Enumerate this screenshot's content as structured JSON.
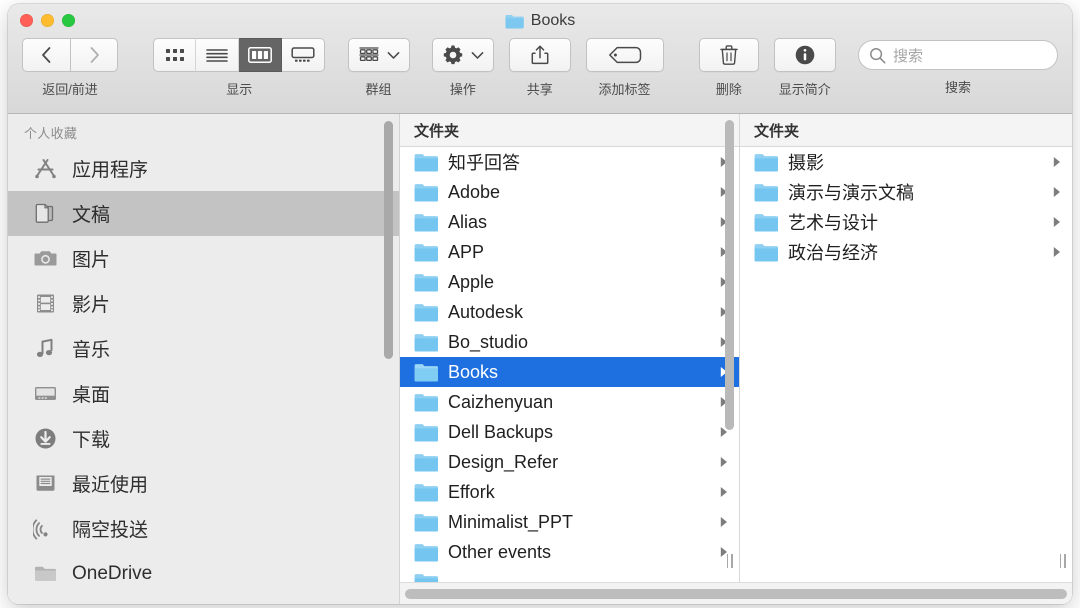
{
  "window": {
    "title": "Books",
    "title_icon": "folder-icon",
    "traffic_lights": [
      {
        "name": "close",
        "color": "#ff5f57"
      },
      {
        "name": "minimize",
        "color": "#febc2e"
      },
      {
        "name": "zoom",
        "color": "#28c840"
      }
    ]
  },
  "toolbar": {
    "nav": {
      "caption": "返回/前进",
      "back_icon": "chevron-left-icon",
      "forward_icon": "chevron-right-icon"
    },
    "view": {
      "caption": "显示",
      "modes": [
        {
          "name": "icon-view",
          "icon": "grid-icon",
          "active": false
        },
        {
          "name": "list-view",
          "icon": "list-icon",
          "active": false
        },
        {
          "name": "column-view",
          "icon": "columns-icon",
          "active": true
        },
        {
          "name": "gallery-view",
          "icon": "gallery-icon",
          "active": false
        }
      ]
    },
    "group": {
      "caption": "群组",
      "icon": "group-rows-icon",
      "chevron": "chevron-down-icon"
    },
    "action": {
      "caption": "操作",
      "icon": "gear-icon",
      "chevron": "chevron-down-icon"
    },
    "share": {
      "caption": "共享",
      "icon": "share-icon"
    },
    "tag": {
      "caption": "添加标签",
      "icon": "tag-icon"
    },
    "delete": {
      "caption": "删除",
      "icon": "trash-icon"
    },
    "info": {
      "caption": "显示简介",
      "icon": "info-circle-icon"
    },
    "search": {
      "caption": "搜索",
      "placeholder": "搜索",
      "value": "",
      "icon": "search-icon"
    }
  },
  "sidebar": {
    "section_title": "个人收藏",
    "items": [
      {
        "label": "应用程序",
        "icon": "applications-icon",
        "selected": false
      },
      {
        "label": "文稿",
        "icon": "documents-icon",
        "selected": true
      },
      {
        "label": "图片",
        "icon": "pictures-camera-icon",
        "selected": false
      },
      {
        "label": "影片",
        "icon": "movies-film-icon",
        "selected": false
      },
      {
        "label": "音乐",
        "icon": "music-note-icon",
        "selected": false
      },
      {
        "label": "桌面",
        "icon": "desktop-monitor-icon",
        "selected": false
      },
      {
        "label": "下载",
        "icon": "downloads-arrow-icon",
        "selected": false
      },
      {
        "label": "最近使用",
        "icon": "recents-tray-icon",
        "selected": false
      },
      {
        "label": "隔空投送",
        "icon": "airdrop-icon",
        "selected": false
      },
      {
        "label": "OneDrive",
        "icon": "gray-folder-icon",
        "selected": false
      }
    ]
  },
  "columns": [
    {
      "header": "文件夹",
      "items": [
        {
          "name": "知乎回答",
          "icon": "folder-icon",
          "has_children": true,
          "selected": false
        },
        {
          "name": "Adobe",
          "icon": "folder-icon",
          "has_children": true,
          "selected": false
        },
        {
          "name": "Alias",
          "icon": "folder-icon",
          "has_children": true,
          "selected": false
        },
        {
          "name": "APP",
          "icon": "folder-icon",
          "has_children": true,
          "selected": false
        },
        {
          "name": "Apple",
          "icon": "folder-icon",
          "has_children": true,
          "selected": false
        },
        {
          "name": "Autodesk",
          "icon": "folder-icon",
          "has_children": true,
          "selected": false
        },
        {
          "name": "Bo_studio",
          "icon": "folder-icon",
          "has_children": true,
          "selected": false
        },
        {
          "name": "Books",
          "icon": "folder-icon",
          "has_children": true,
          "selected": true
        },
        {
          "name": "Caizhenyuan",
          "icon": "folder-icon",
          "has_children": true,
          "selected": false
        },
        {
          "name": "Dell Backups",
          "icon": "folder-icon",
          "has_children": true,
          "selected": false
        },
        {
          "name": "Design_Refer",
          "icon": "folder-icon",
          "has_children": true,
          "selected": false
        },
        {
          "name": "Effork",
          "icon": "folder-icon",
          "has_children": true,
          "selected": false
        },
        {
          "name": "Minimalist_PPT",
          "icon": "folder-icon",
          "has_children": true,
          "selected": false
        },
        {
          "name": "Other events",
          "icon": "folder-icon",
          "has_children": true,
          "selected": false
        }
      ]
    },
    {
      "header": "文件夹",
      "items": [
        {
          "name": "摄影",
          "icon": "folder-icon",
          "has_children": true,
          "selected": false
        },
        {
          "name": "演示与演示文稿",
          "icon": "folder-icon",
          "has_children": true,
          "selected": false
        },
        {
          "name": "艺术与设计",
          "icon": "folder-icon",
          "has_children": true,
          "selected": false
        },
        {
          "name": "政治与经济",
          "icon": "folder-icon",
          "has_children": true,
          "selected": false
        }
      ]
    }
  ],
  "colors": {
    "selection_blue": "#1e6fe0",
    "folder_blue": "#6fc3f0",
    "sidebar_bg": "#ececec",
    "toolbar_bg": "#e4e4e4",
    "sidebar_selection": "#c3c3c3"
  }
}
